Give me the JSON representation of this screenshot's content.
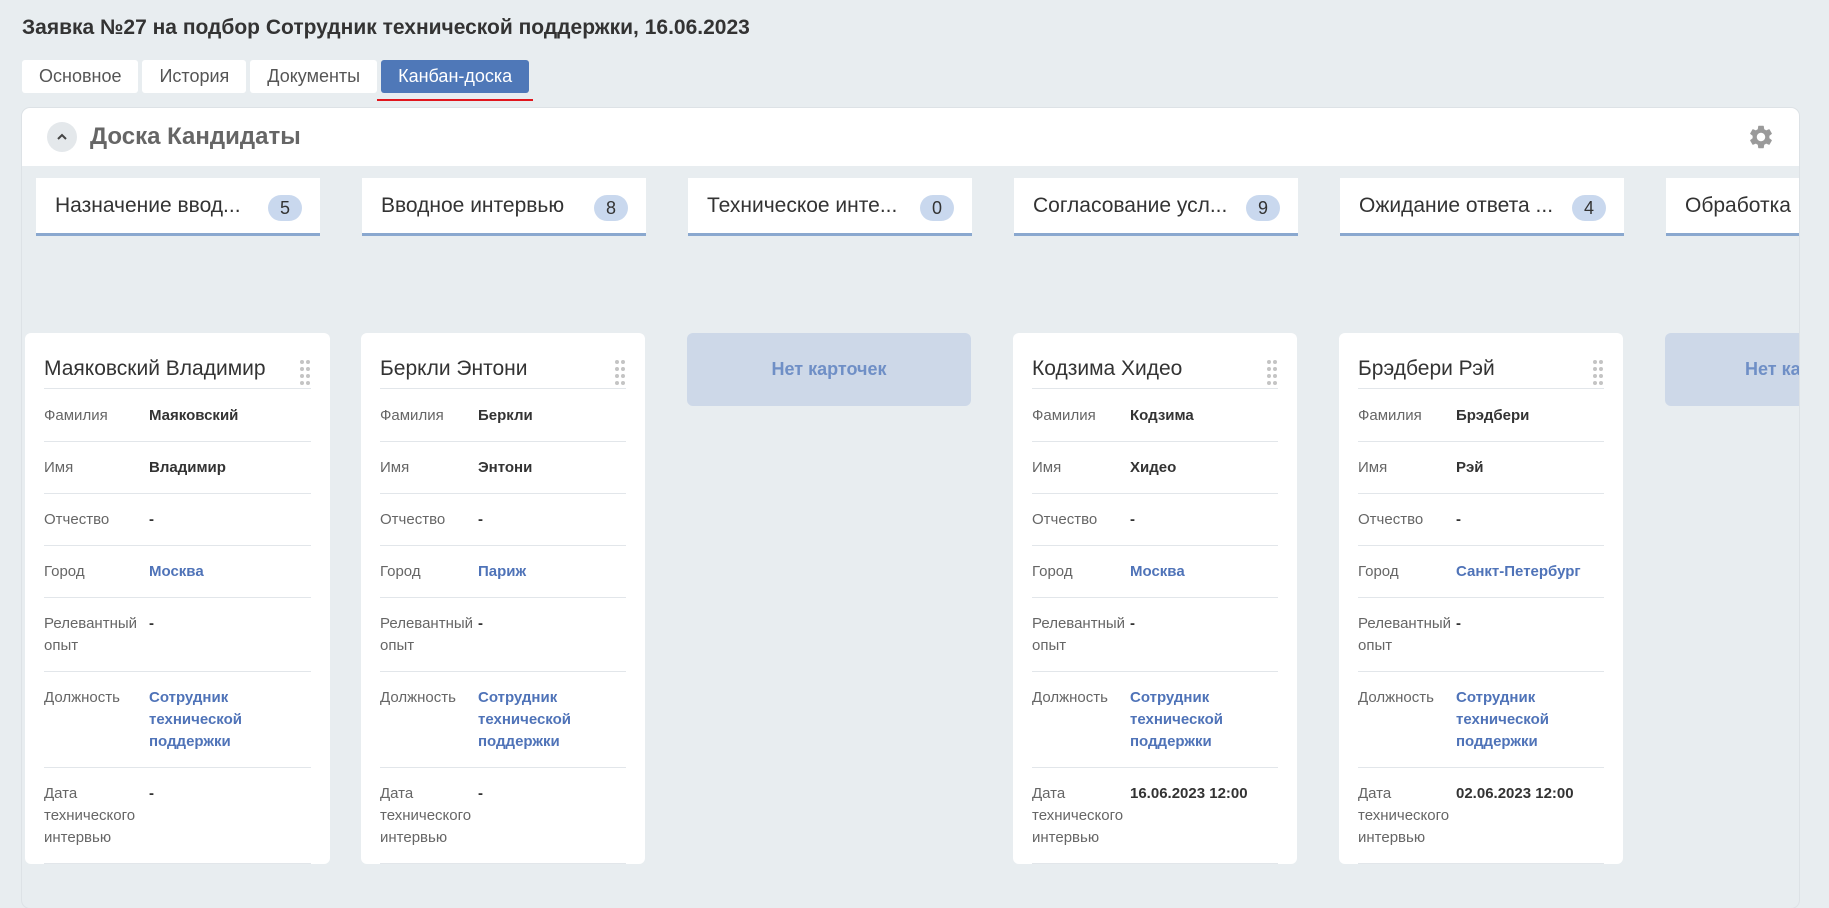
{
  "page": {
    "title": "Заявка №27 на подбор Сотрудник технической поддержки, 16.06.2023"
  },
  "tabs": [
    {
      "label": "Основное"
    },
    {
      "label": "История"
    },
    {
      "label": "Документы"
    },
    {
      "label": "Канбан-доска",
      "active": true
    }
  ],
  "board": {
    "title": "Доска Кандидаты",
    "collapse_icon": "chevron-up-icon",
    "settings_icon": "gear-icon",
    "empty_text": "Нет карточек",
    "empty_text_partial": "Нет ка"
  },
  "field_labels": {
    "last_name": "Фамилия",
    "first_name": "Имя",
    "patronymic": "Отчество",
    "city": "Город",
    "experience": "Релевантный опыт",
    "position": "Должность",
    "tech_interview_date": "Дата технического интервью"
  },
  "columns": [
    {
      "title": "Назначение ввод...",
      "count": "5",
      "card": {
        "name": "Маяковский Владимир",
        "last_name": "Маяковский",
        "first_name": "Владимир",
        "patronymic": "-",
        "city": "Москва",
        "experience": "-",
        "position": "Сотрудник технической поддержки",
        "tech_interview_date": "-"
      }
    },
    {
      "title": "Вводное интервью",
      "count": "8",
      "card": {
        "name": "Беркли Энтони",
        "last_name": "Беркли",
        "first_name": "Энтони",
        "patronymic": "-",
        "city": "Париж",
        "experience": "-",
        "position": "Сотрудник технической поддержки",
        "tech_interview_date": "-"
      }
    },
    {
      "title": "Техническое инте...",
      "count": "0",
      "card": null
    },
    {
      "title": "Согласование усл...",
      "count": "9",
      "card": {
        "name": "Кодзима Хидео",
        "last_name": "Кодзима",
        "first_name": "Хидео",
        "patronymic": "-",
        "city": "Москва",
        "experience": "-",
        "position": "Сотрудник технической поддержки",
        "tech_interview_date": "16.06.2023 12:00"
      }
    },
    {
      "title": "Ожидание ответа ...",
      "count": "4",
      "card": {
        "name": "Брэдбери Рэй",
        "last_name": "Брэдбери",
        "first_name": "Рэй",
        "patronymic": "-",
        "city": "Санкт-Петербург",
        "experience": "-",
        "position": "Сотрудник технической поддержки",
        "tech_interview_date": "02.06.2023 12:00"
      }
    },
    {
      "title": "Обработка",
      "count": "",
      "card": null
    }
  ]
}
